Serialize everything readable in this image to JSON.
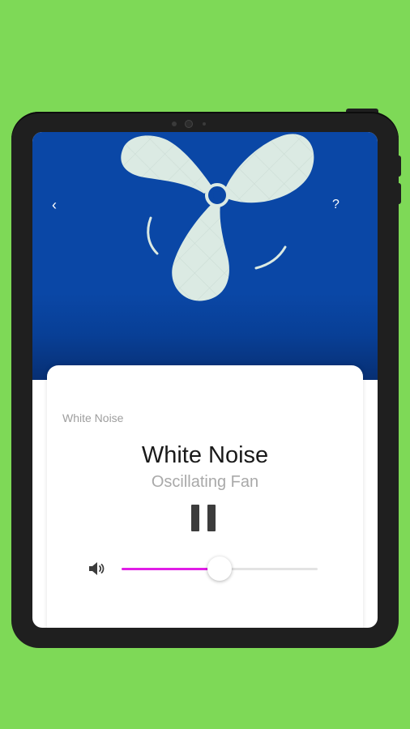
{
  "nav": {
    "back_label": "‹",
    "help_label": "?"
  },
  "player": {
    "caption": "White Noise",
    "title": "White Noise",
    "subtitle": "Oscillating Fan",
    "state": "playing"
  },
  "volume": {
    "level": 0.5
  },
  "colors": {
    "background": "#7ed957",
    "hero": "#0a47a6",
    "accent": "#e01ee6",
    "fan": "#dbeae3"
  },
  "icons": {
    "illustration": "fan-icon",
    "play_control": "pause-icon",
    "volume": "speaker-icon"
  }
}
